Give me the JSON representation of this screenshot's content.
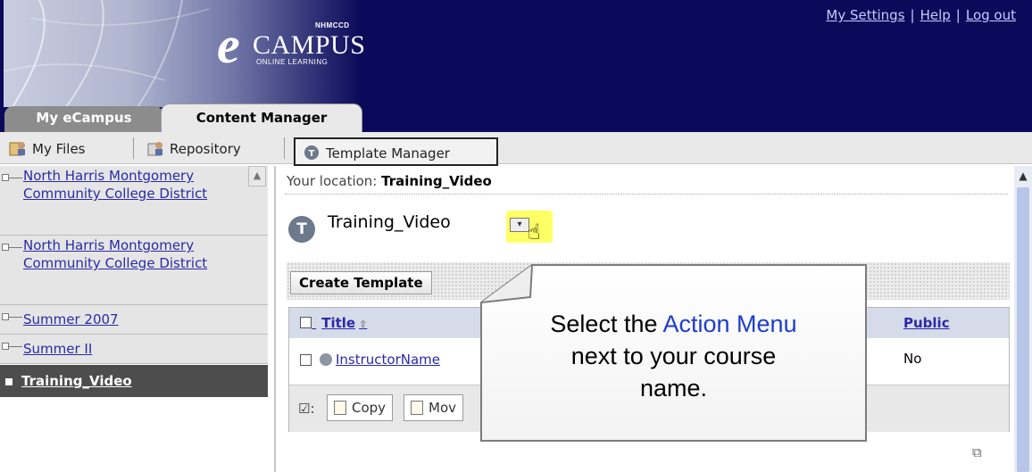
{
  "header": {
    "logo": {
      "top_text": "NHMCCD",
      "brand_e": "e",
      "brand_campus": "CAMPUS",
      "sub_text": "ONLINE LEARNING"
    },
    "links": [
      {
        "label": "My Settings"
      },
      {
        "label": "Help"
      },
      {
        "label": "Log out"
      }
    ],
    "link_separator": "|"
  },
  "tabs": [
    {
      "label": "My eCampus",
      "active": false
    },
    {
      "label": "Content Manager",
      "active": true
    }
  ],
  "toolbar": {
    "items": [
      {
        "label": "My Files",
        "icon": "my-files-icon"
      },
      {
        "label": "Repository",
        "icon": "repository-icon"
      },
      {
        "label": "Template Manager",
        "icon": "template-manager-icon",
        "selected": true
      }
    ]
  },
  "sidebar": {
    "items": [
      {
        "label": "North Harris Montgomery Community College District"
      },
      {
        "label": "North Harris Montgomery Community College District"
      },
      {
        "label": "Summer 2007"
      },
      {
        "label": "Summer II"
      },
      {
        "label": "Training_Video",
        "active": true
      }
    ]
  },
  "main": {
    "location_prefix": "Your location:",
    "location_value": "Training_Video",
    "heading": "Training_Video",
    "heading_icon_letter": "T",
    "create_button": "Create Template",
    "table": {
      "columns": [
        {
          "label": "Title"
        },
        {
          "label": "Public"
        }
      ],
      "rows": [
        {
          "title": "InstructorName",
          "public": "No"
        }
      ],
      "footer_buttons": [
        {
          "label": "Copy"
        },
        {
          "label": "Mov"
        }
      ]
    }
  },
  "callout": {
    "text_before": "Select the ",
    "text_highlight": "Action Menu",
    "text_after": "next to your course name."
  },
  "colors": {
    "banner": "#0b0a5a",
    "link": "#2a2aa8",
    "highlight": "#ffff66",
    "callout_accent": "#1d3ccf",
    "active_nav": "#4d4d4d"
  }
}
